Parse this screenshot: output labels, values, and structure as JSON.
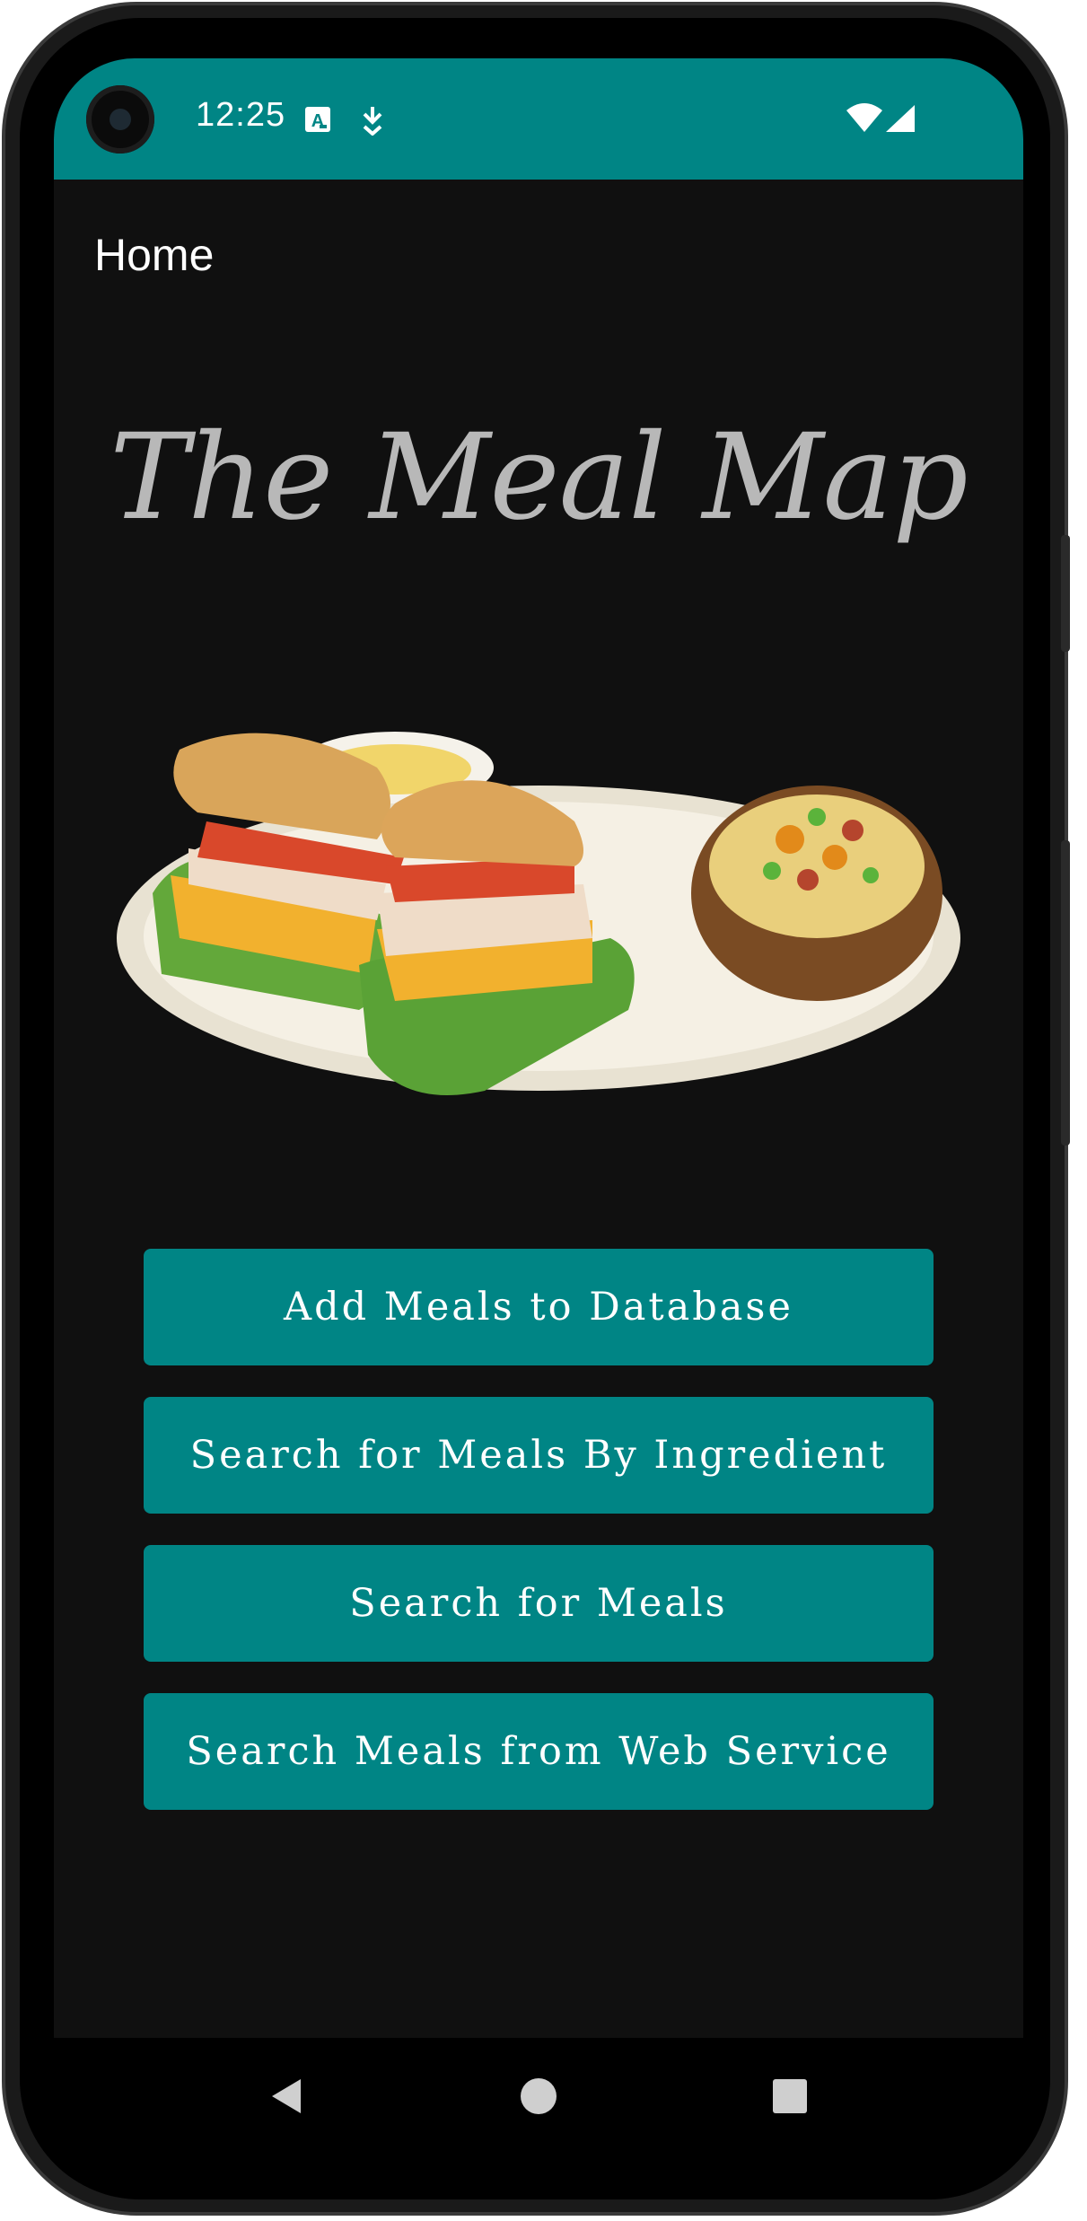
{
  "status_bar": {
    "time": "12:25",
    "color": "#008585",
    "icons": [
      "accessibility-a-icon",
      "download-icon",
      "wifi-icon",
      "signal-icon"
    ]
  },
  "app_bar": {
    "title": "Home"
  },
  "brand": {
    "title": "The Meal Map"
  },
  "hero_image": {
    "icon": "sandwich-and-baked-potato-plate"
  },
  "buttons": {
    "add_meals": "Add Meals to Database",
    "search_by_ingredient": "Search for Meals By Ingredient",
    "search_meals": "Search for Meals",
    "search_web": "Search Meals from Web Service"
  },
  "nav_bar": {
    "icons": [
      "back-icon",
      "home-icon",
      "recents-icon"
    ]
  },
  "colors": {
    "accent": "#008585",
    "background": "#101010",
    "title_text": "#b8b8b8"
  }
}
